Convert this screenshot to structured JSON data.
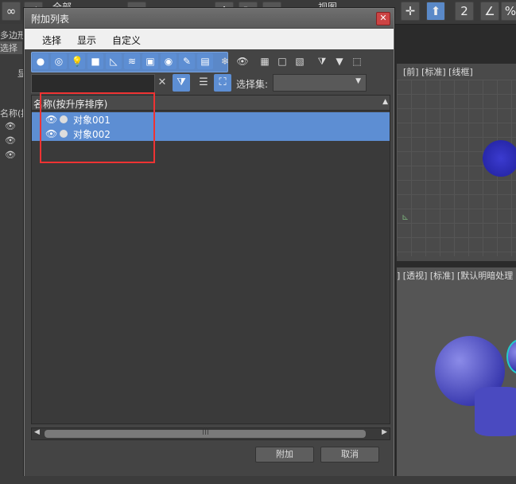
{
  "background": {
    "toolbar_label_1": "全部",
    "toolbar_label_2": "视图",
    "left_labels": [
      "多边形式",
      "选择",
      "显"
    ],
    "left_list_header": "名称(按",
    "viewport_top_label": "[前] [标准] [线框]",
    "viewport_persp_label": "] [透视] [标准] [默认明暗处理"
  },
  "dialog": {
    "title": "附加列表",
    "menu": [
      "选择",
      "显示",
      "自定义"
    ],
    "search": {
      "value": "",
      "placeholder": ""
    },
    "selection_set_label": "选择集:",
    "selection_set_value": "",
    "list_header": "名称(按升序排序)",
    "objects": [
      {
        "name": "对象001",
        "selected": true
      },
      {
        "name": "对象002",
        "selected": true
      }
    ],
    "attach_button": "附加",
    "cancel_button": "取消"
  },
  "colors": {
    "accent": "#5d8ed3",
    "highlight_box": "#e33333"
  }
}
